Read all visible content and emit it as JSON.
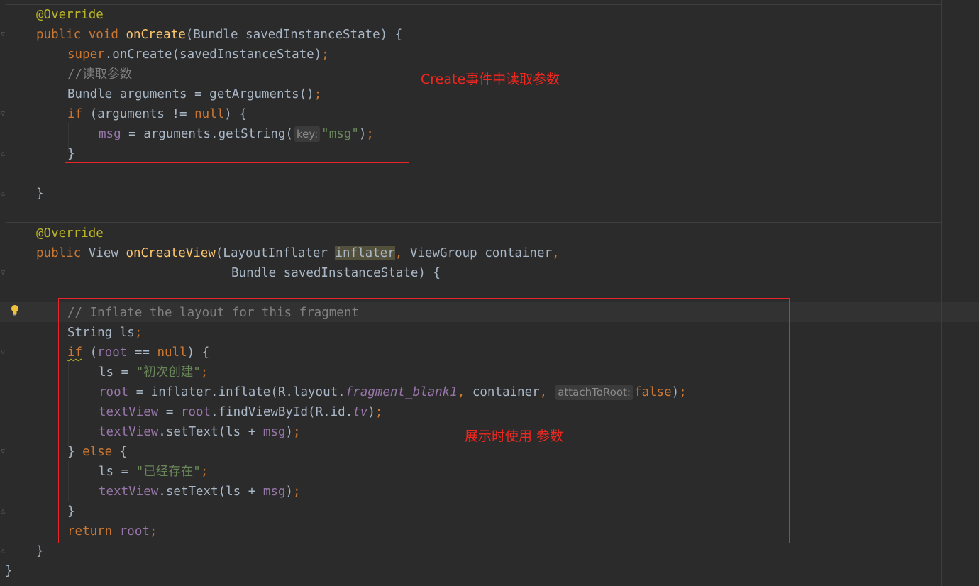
{
  "colors": {
    "background": "#2b2b2b",
    "keyword": "#cc7832",
    "annotation": "#bbb529",
    "method": "#ffc66d",
    "field": "#9876aa",
    "string": "#6a8759",
    "comment": "#808080",
    "annotation_box": "#e8262a"
  },
  "code": {
    "override1": "@Override",
    "l2_public": "public ",
    "l2_void": "void ",
    "l2_fn": "onCreate",
    "l2_rest": "(Bundle savedInstanceState) {",
    "l3_super": "super",
    "l3_rest": ".onCreate(savedInstanceState)",
    "l3_semi": ";",
    "l4_comment": "//读取参数",
    "l5_decl": "Bundle arguments = getArguments()",
    "l5_semi": ";",
    "l6_if": "if ",
    "l6_cond": "(arguments != ",
    "l6_null": "null",
    "l6_end": ") {",
    "l7_field": "msg",
    "l7_mid": " = arguments.getString(",
    "l7_hint": "key:",
    "l7_str": "\"msg\"",
    "l7_end": ")",
    "l7_semi": ";",
    "l8_close": "}",
    "l10_close": "}",
    "override2": "@Override",
    "l12_public": "public ",
    "l12_type": "View ",
    "l12_fn": "onCreateView",
    "l12_p1": "(LayoutInflater ",
    "l12_hl": "inflater",
    "l12_comma": ",",
    "l12_p2": " ViewGroup container",
    "l12_comma2": ",",
    "l13_params": "Bundle savedInstanceState) {",
    "l15_comment": "// Inflate the layout for this fragment",
    "l16_decl": "String ls",
    "l16_semi": ";",
    "l17_if": "if",
    "l17_open": " (",
    "l17_root": "root",
    "l17_eq": " == ",
    "l17_null": "null",
    "l17_end": ") {",
    "l18_ls": "ls = ",
    "l18_str": "\"初次创建\"",
    "l18_semi": ";",
    "l19_root": "root",
    "l19_mid": " = inflater.inflate(R.layout.",
    "l19_it": "fragment_blank1",
    "l19_comma": ",",
    "l19_cont": " container",
    "l19_comma2": ",",
    "l19_hint": "attachToRoot:",
    "l19_false": "false",
    "l19_end": ")",
    "l19_semi": ";",
    "l20_tv": "textView",
    "l20_eq": " = ",
    "l20_root": "root",
    "l20_mid": ".findViewById(R.id.",
    "l20_it": "tv",
    "l20_end": ")",
    "l20_semi": ";",
    "l21_tv": "textView",
    "l21_mid": ".setText(ls + ",
    "l21_msg": "msg",
    "l21_end": ")",
    "l21_semi": ";",
    "l22_close": "} ",
    "l22_else": "else",
    "l22_open": " {",
    "l23_ls": "ls = ",
    "l23_str": "\"已经存在\"",
    "l23_semi": ";",
    "l24_tv": "textView",
    "l24_mid": ".setText(ls + ",
    "l24_msg": "msg",
    "l24_end": ")",
    "l24_semi": ";",
    "l25_close": "}",
    "l26_return": "return ",
    "l26_root": "root",
    "l26_semi": ";",
    "l27_close": "}",
    "l28_close": "}"
  },
  "annotations": {
    "note1": "Create事件中读取参数",
    "note2": "展示时使用 参数"
  },
  "icons": {
    "intention": "lightbulb-icon"
  }
}
